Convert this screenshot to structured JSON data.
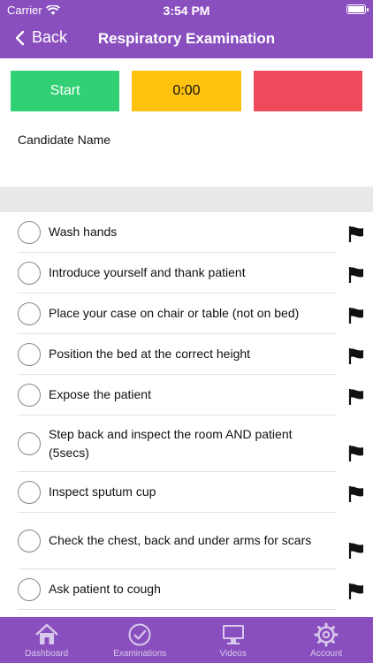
{
  "status": {
    "carrier": "Carrier",
    "time": "3:54 PM"
  },
  "nav": {
    "back_label": "Back",
    "title": "Respiratory Examination"
  },
  "controls": {
    "start_label": "Start",
    "timer": "0:00"
  },
  "candidate": {
    "label": "Candidate Name"
  },
  "checklist": [
    "Wash hands",
    "Introduce yourself and thank patient",
    "Place your case on chair or table (not on bed)",
    "Position the bed at the correct height",
    "Expose the patient",
    "Step back and inspect the room AND patient (5secs)",
    "Inspect sputum cup",
    "Check the chest, back and under arms for scars",
    "Ask patient to cough"
  ],
  "tabs": [
    "Dashboard",
    "Examinations",
    "Videos",
    "Account"
  ],
  "colors": {
    "primary": "#8a4fbe",
    "start": "#32d074",
    "timer": "#ffc20e",
    "stop": "#ee4a5b"
  },
  "icons": {
    "item_status": "radio-circle-icon",
    "item_flag": "flag-icon",
    "tab_icons": [
      "home-icon",
      "checkmark-circle-icon",
      "monitor-icon",
      "gear-icon"
    ]
  }
}
